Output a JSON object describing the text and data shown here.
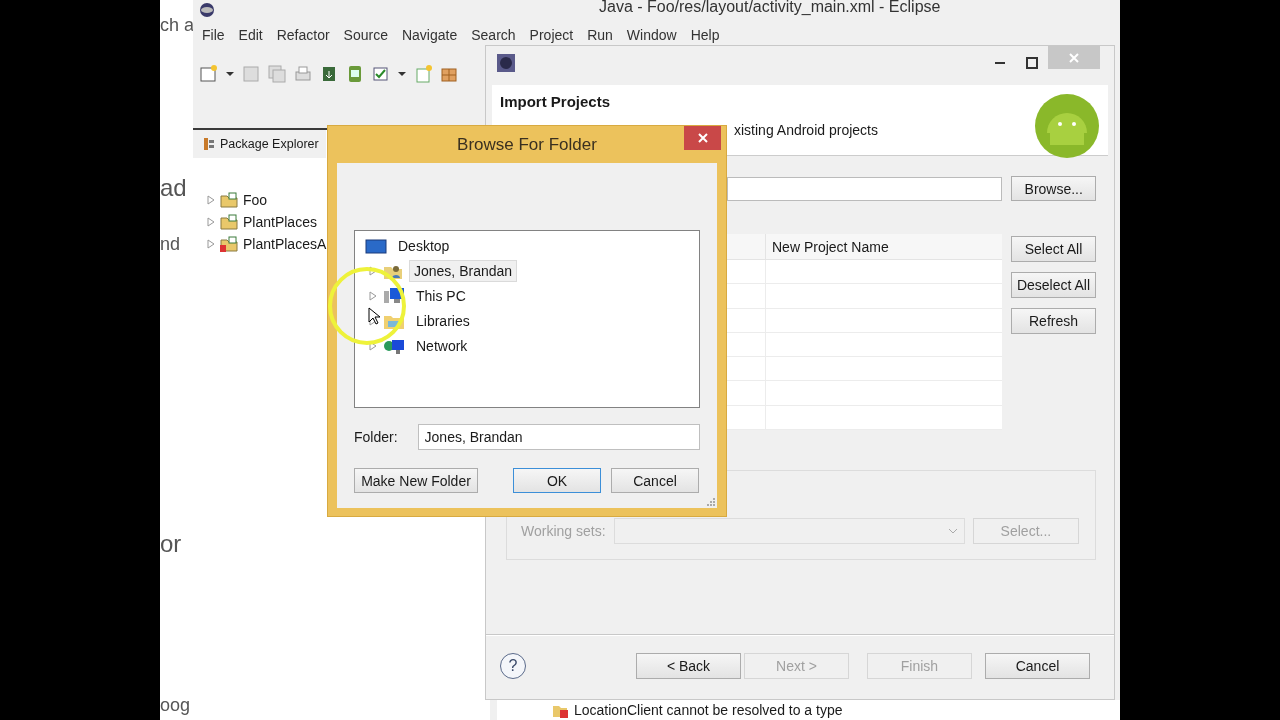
{
  "background_window": {
    "fragments": [
      "ch a",
      "ad",
      "nd",
      "or",
      "oog"
    ]
  },
  "eclipse": {
    "title": "Java - Foo/res/layout/activity_main.xml - Eclipse",
    "menu": [
      "File",
      "Edit",
      "Refactor",
      "Source",
      "Navigate",
      "Search",
      "Project",
      "Run",
      "Window",
      "Help"
    ],
    "package_explorer": {
      "tab": "Package Explorer",
      "items": [
        {
          "label": "Foo",
          "error": false
        },
        {
          "label": "PlantPlaces",
          "error": false
        },
        {
          "label": "PlantPlacesA",
          "error": true
        }
      ]
    },
    "problems": {
      "message": "LocationClient cannot be resolved to a type"
    }
  },
  "import_wizard": {
    "title": "Import Projects",
    "help": "?",
    "message": "xisting Android projects",
    "browse": "Browse...",
    "columns": [
      "New Project Name"
    ],
    "side_buttons": [
      "Select All",
      "Deselect All",
      "Refresh"
    ],
    "working_sets": {
      "label": "Working sets:",
      "button": "Select...",
      "disabled": true
    },
    "footer_buttons": [
      {
        "label": "< Back",
        "disabled": false
      },
      {
        "label": "Next >",
        "disabled": true
      },
      {
        "label": "Finish",
        "disabled": true
      },
      {
        "label": "Cancel",
        "disabled": false
      }
    ]
  },
  "browse_dialog": {
    "title": "Browse For Folder",
    "tree": [
      {
        "label": "Desktop",
        "selected": false,
        "children": [
          {
            "label": "Jones, Brandan",
            "selected": true
          },
          {
            "label": "This PC",
            "selected": false
          },
          {
            "label": "Libraries",
            "selected": false
          },
          {
            "label": "Network",
            "selected": false
          }
        ]
      }
    ],
    "folder": {
      "label": "Folder:",
      "value": "Jones, Brandan"
    },
    "buttons": [
      {
        "label": "Make New Folder",
        "default": false
      },
      {
        "label": "OK",
        "default": true
      },
      {
        "label": "Cancel",
        "default": false
      }
    ]
  }
}
